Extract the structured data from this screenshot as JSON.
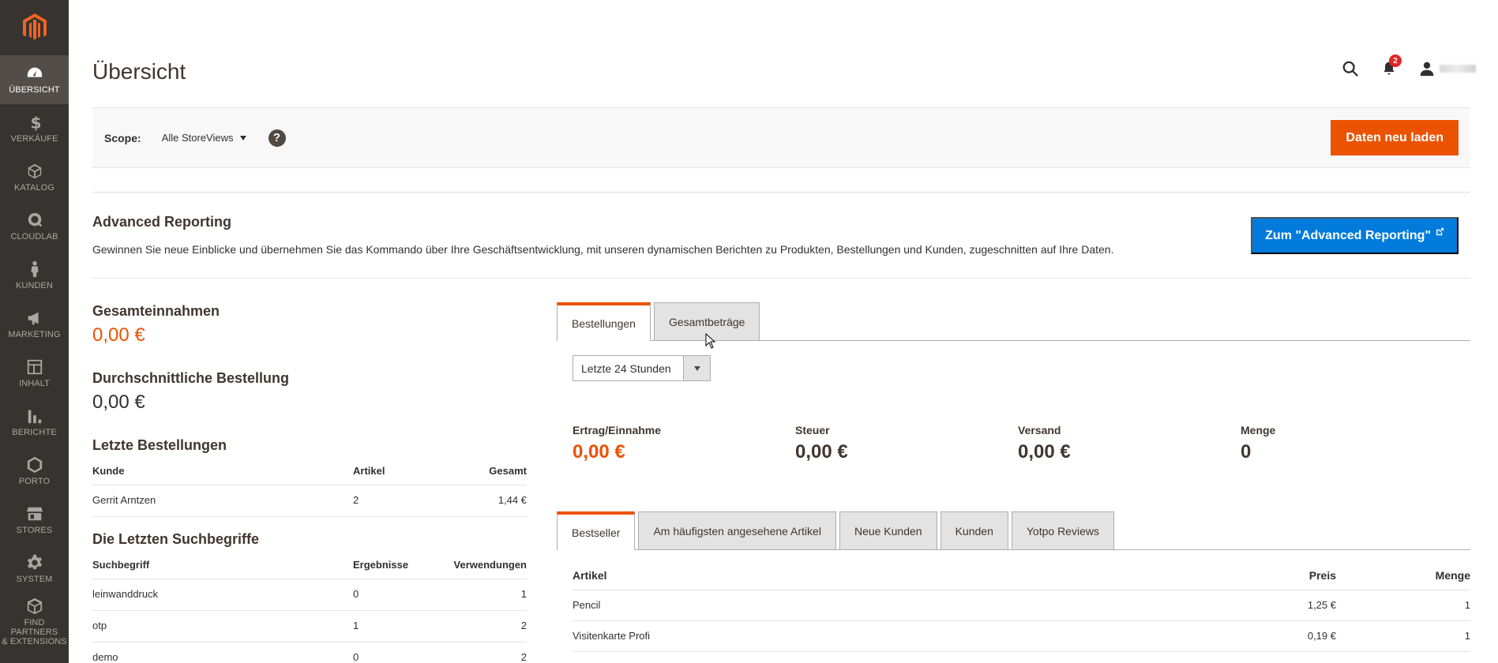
{
  "sidebar": {
    "items": [
      {
        "label": "ÜBERSICHT",
        "icon": "dashboard-icon"
      },
      {
        "label": "VERKÄUFE",
        "icon": "dollar-icon"
      },
      {
        "label": "KATALOG",
        "icon": "box-icon"
      },
      {
        "label": "CLOUDLAB",
        "icon": "cloudlab-icon"
      },
      {
        "label": "KUNDEN",
        "icon": "person-icon"
      },
      {
        "label": "MARKETING",
        "icon": "megaphone-icon"
      },
      {
        "label": "INHALT",
        "icon": "layout-icon"
      },
      {
        "label": "BERICHTE",
        "icon": "bar-chart-icon"
      },
      {
        "label": "PORTO",
        "icon": "hexagon-icon"
      },
      {
        "label": "STORES",
        "icon": "store-icon"
      },
      {
        "label": "SYSTEM",
        "icon": "gear-icon"
      },
      {
        "label1": "FIND PARTNERS",
        "label2": "& EXTENSIONS",
        "icon": "partners-icon"
      }
    ]
  },
  "header": {
    "title": "Übersicht",
    "notifications_count": "2"
  },
  "scope": {
    "label": "Scope:",
    "value": "Alle StoreViews",
    "help": "?",
    "reload_label": "Daten neu laden"
  },
  "advanced_reporting": {
    "title": "Advanced Reporting",
    "description": "Gewinnen Sie neue Einblicke und übernehmen Sie das Kommando über Ihre Geschäftsentwicklung, mit unseren dynamischen Berichten zu Produkten, Bestellungen und Kunden, zugeschnitten auf Ihre Daten.",
    "button_label": "Zum \"Advanced Reporting\""
  },
  "stats": {
    "revenue_title": "Gesamteinnahmen",
    "revenue_value": "0,00 €",
    "avg_title": "Durchschnittliche Bestellung",
    "avg_value": "0,00 €"
  },
  "last_orders": {
    "title": "Letzte Bestellungen",
    "headers": [
      "Kunde",
      "Artikel",
      "Gesamt"
    ],
    "rows": [
      [
        "Gerrit Arntzen",
        "2",
        "1,44 €"
      ]
    ]
  },
  "last_searches": {
    "title": "Die Letzten Suchbegriffe",
    "headers": [
      "Suchbegriff",
      "Ergebnisse",
      "Verwendungen"
    ],
    "rows": [
      [
        "leinwanddruck",
        "0",
        "1"
      ],
      [
        "otp",
        "1",
        "2"
      ],
      [
        "demo",
        "0",
        "2"
      ]
    ]
  },
  "chart_tabs": {
    "tab1": "Bestellungen",
    "tab2": "Gesamtbeträge",
    "period": "Letzte 24 Stunden"
  },
  "totals": {
    "revenue_label": "Ertrag/Einnahme",
    "revenue_value": "0,00 €",
    "tax_label": "Steuer",
    "tax_value": "0,00 €",
    "shipping_label": "Versand",
    "shipping_value": "0,00 €",
    "qty_label": "Menge",
    "qty_value": "0"
  },
  "product_tabs": {
    "tab1": "Bestseller",
    "tab2": "Am häufigsten angesehene Artikel",
    "tab3": "Neue Kunden",
    "tab4": "Kunden",
    "tab5": "Yotpo Reviews"
  },
  "bestsellers": {
    "headers": [
      "Artikel",
      "Preis",
      "Menge"
    ],
    "rows": [
      [
        "Pencil",
        "1,25 €",
        "1"
      ],
      [
        "Visitenkarte Profi",
        "0,19 €",
        "1"
      ]
    ]
  },
  "colors": {
    "accent": "#eb5202",
    "link_button": "#007bdb",
    "sidebar": "#373330"
  }
}
